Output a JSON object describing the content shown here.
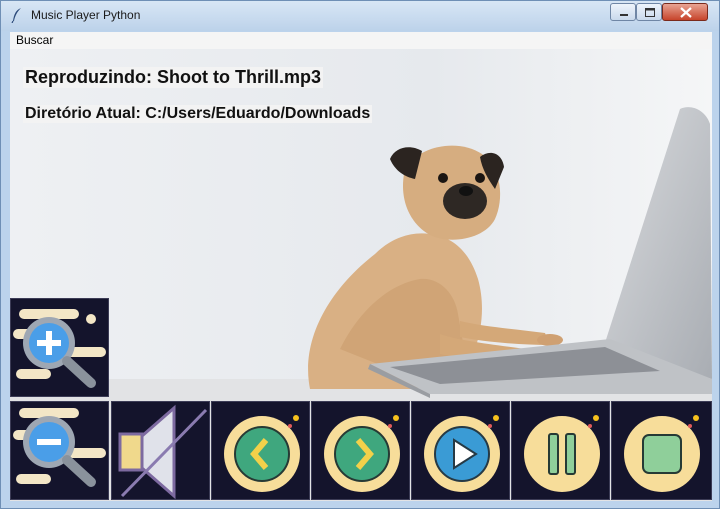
{
  "window": {
    "title": "Music Player Python",
    "controls": [
      "minimize-icon",
      "maximize-icon",
      "close-icon"
    ]
  },
  "menu": {
    "items": [
      "Buscar"
    ]
  },
  "status": {
    "now_playing": "Reproduzindo: Shoot to Thrill.mp3",
    "directory": "Diretório Atual: C:/Users/Eduardo/Downloads"
  },
  "buttons": [
    {
      "icon": "zoom-in-icon"
    },
    {
      "icon": "zoom-out-icon"
    },
    {
      "icon": "mute-icon"
    },
    {
      "icon": "previous-icon"
    },
    {
      "icon": "next-icon"
    },
    {
      "icon": "play-icon"
    },
    {
      "icon": "pause-icon"
    },
    {
      "icon": "stop-icon"
    }
  ],
  "colors": {
    "button_bg": "#14142c",
    "disc": "#f7dd9a",
    "accent_green": "#3fa77e",
    "accent_blue": "#3a9bd5"
  }
}
